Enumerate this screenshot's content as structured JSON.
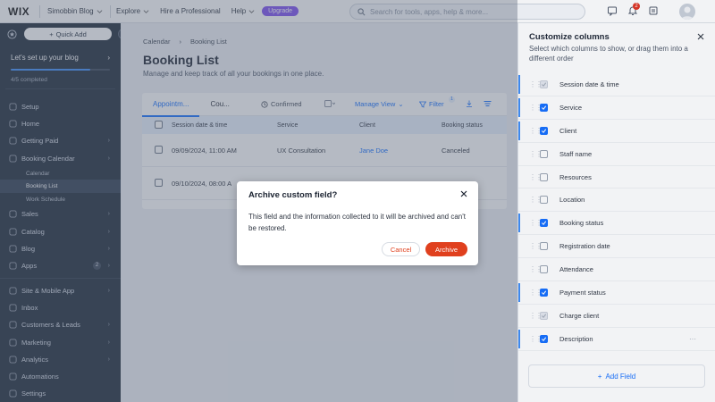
{
  "topbar": {
    "logo": "WIX",
    "site_name": "Simobbin Blog",
    "menu": [
      "Explore",
      "Hire a Professional",
      "Help"
    ],
    "upgrade": "Upgrade",
    "search_placeholder": "Search for tools, apps, help & more...",
    "notifications_count": "2"
  },
  "sidebar": {
    "quick_add": "Quick Add",
    "setup_title": "Let's set up your blog",
    "setup_count": "4/5 completed",
    "setup_progress": 0.8,
    "items_top": [
      {
        "label": "Setup",
        "icon": "setup-icon",
        "chevron": false
      },
      {
        "label": "Home",
        "icon": "home-icon",
        "chevron": false
      },
      {
        "label": "Getting Paid",
        "icon": "getting-paid-icon",
        "chevron": true
      },
      {
        "label": "Booking Calendar",
        "icon": "calendar-icon",
        "chevron": true
      }
    ],
    "sub_items": [
      {
        "label": "Calendar",
        "active": false
      },
      {
        "label": "Booking List",
        "active": true
      },
      {
        "label": "Work Schedule",
        "active": false
      }
    ],
    "items_mid": [
      {
        "label": "Sales",
        "icon": "sales-icon",
        "chevron": true
      },
      {
        "label": "Catalog",
        "icon": "catalog-icon",
        "chevron": true
      },
      {
        "label": "Blog",
        "icon": "blog-icon",
        "chevron": true
      },
      {
        "label": "Apps",
        "icon": "apps-icon",
        "chevron": true,
        "badge": "2"
      }
    ],
    "items_bottom": [
      {
        "label": "Site & Mobile App",
        "icon": "site-icon",
        "chevron": true
      },
      {
        "label": "Inbox",
        "icon": "inbox-icon",
        "chevron": false
      },
      {
        "label": "Customers & Leads",
        "icon": "customers-icon",
        "chevron": true
      },
      {
        "label": "Marketing",
        "icon": "marketing-icon",
        "chevron": true
      },
      {
        "label": "Analytics",
        "icon": "analytics-icon",
        "chevron": true
      },
      {
        "label": "Automations",
        "icon": "automations-icon",
        "chevron": false
      },
      {
        "label": "Settings",
        "icon": "settings-icon",
        "chevron": false
      }
    ]
  },
  "main": {
    "breadcrumb": [
      "Calendar",
      "Booking List"
    ],
    "title": "Booking List",
    "subtitle": "Manage and keep track of all your bookings in one place.",
    "tabs": [
      "Appointm...",
      "Cou..."
    ],
    "toolbar": {
      "confirmed": "Confirmed",
      "manage_view": "Manage View",
      "filter": "Filter",
      "filter_count": "1"
    },
    "columns": [
      "Session date & time",
      "Service",
      "Client",
      "Booking status"
    ],
    "rows": [
      {
        "date": "09/09/2024, 11:00 AM",
        "service": "UX Consultation",
        "client": "Jane Doe",
        "status": "Canceled"
      },
      {
        "date": "09/10/2024, 08:00 A",
        "service": "",
        "client": "",
        "status": ""
      }
    ]
  },
  "panel": {
    "title": "Customize columns",
    "subtitle": "Select which columns to show, or drag them into a different order",
    "columns": [
      {
        "label": "Session date & time",
        "state": "disabled",
        "highlight": true
      },
      {
        "label": "Service",
        "state": "checked",
        "highlight": true
      },
      {
        "label": "Client",
        "state": "checked",
        "highlight": true
      },
      {
        "label": "Staff name",
        "state": "unchecked",
        "highlight": false
      },
      {
        "label": "Resources",
        "state": "unchecked",
        "highlight": false
      },
      {
        "label": "Location",
        "state": "unchecked",
        "highlight": false
      },
      {
        "label": "Booking status",
        "state": "checked",
        "highlight": true
      },
      {
        "label": "Registration date",
        "state": "unchecked",
        "highlight": false
      },
      {
        "label": "Attendance",
        "state": "unchecked",
        "highlight": false
      },
      {
        "label": "Payment status",
        "state": "checked",
        "highlight": true
      },
      {
        "label": "Charge client",
        "state": "disabled",
        "highlight": false
      },
      {
        "label": "Description",
        "state": "checked",
        "highlight": true
      }
    ],
    "add_field": "Add Field"
  },
  "dialog": {
    "title": "Archive custom field?",
    "body": "This field and the information collected to it will be archived and can't be restored.",
    "cancel": "Cancel",
    "archive": "Archive"
  },
  "colors": {
    "accent": "#116dff",
    "danger": "#e0401e",
    "upgrade": "#7c4ef0",
    "sidebar": "#1c2838"
  }
}
